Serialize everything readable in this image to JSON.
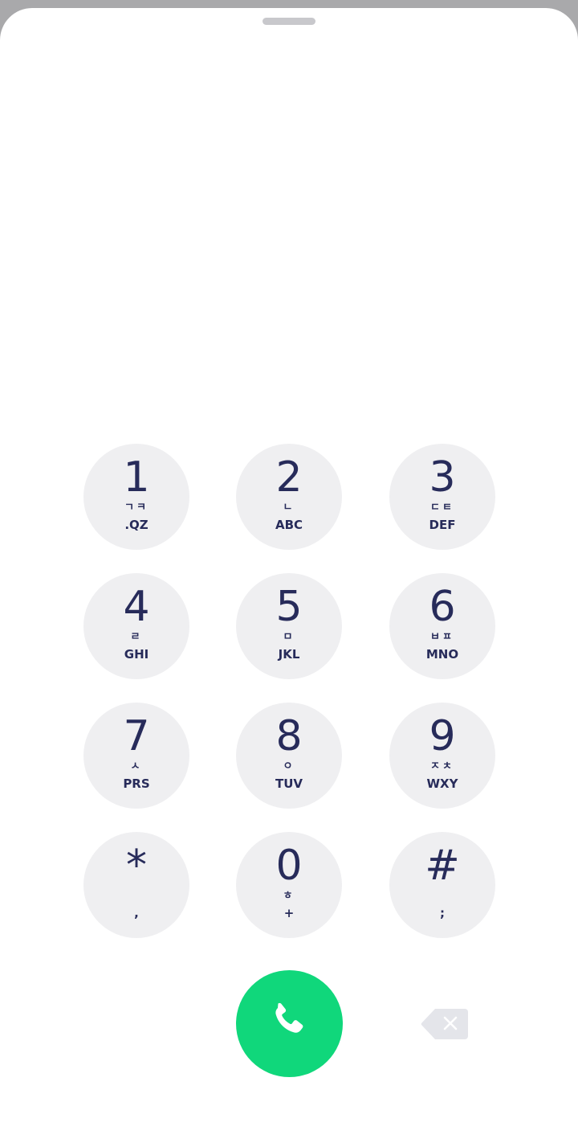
{
  "keypad": {
    "keys": [
      {
        "digit": "1",
        "hangul": "ㄱㅋ",
        "letters": ".QZ"
      },
      {
        "digit": "2",
        "hangul": "ㄴ",
        "letters": "ABC"
      },
      {
        "digit": "3",
        "hangul": "ㄷㅌ",
        "letters": "DEF"
      },
      {
        "digit": "4",
        "hangul": "ㄹ",
        "letters": "GHI"
      },
      {
        "digit": "5",
        "hangul": "ㅁ",
        "letters": "JKL"
      },
      {
        "digit": "6",
        "hangul": "ㅂㅍ",
        "letters": "MNO"
      },
      {
        "digit": "7",
        "hangul": "ㅅ",
        "letters": "PRS"
      },
      {
        "digit": "8",
        "hangul": "ㅇ",
        "letters": "TUV"
      },
      {
        "digit": "9",
        "hangul": "ㅈㅊ",
        "letters": "WXY"
      },
      {
        "digit": "*",
        "hangul": "",
        "letters": ","
      },
      {
        "digit": "0",
        "hangul": "ㅎ",
        "letters": "+"
      },
      {
        "digit": "#",
        "hangul": "",
        "letters": ";"
      }
    ]
  },
  "actions": {
    "call_icon": "phone-icon",
    "call_color": "#10d77b",
    "backspace_icon": "backspace-icon"
  },
  "colors": {
    "key_bg": "#efeff1",
    "key_text": "#272b5a"
  }
}
